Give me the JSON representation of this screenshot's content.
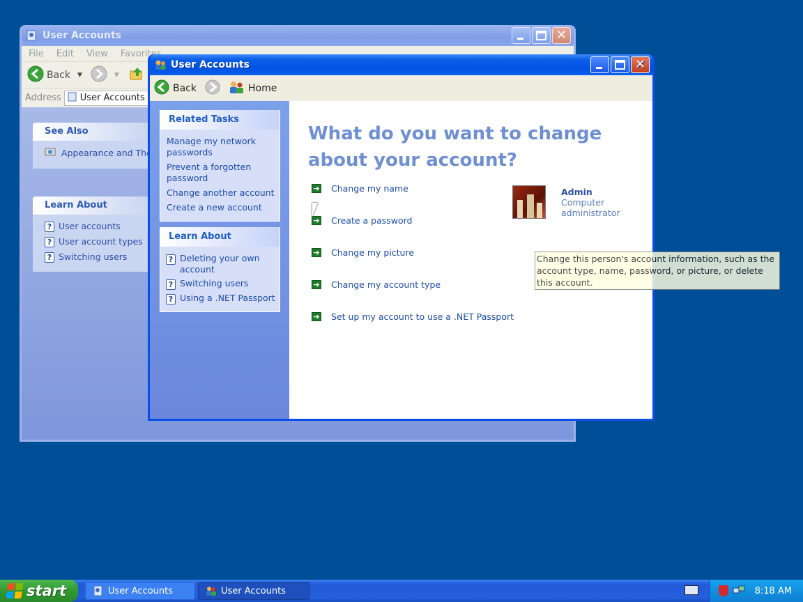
{
  "colors": {
    "desktop": "#004e98",
    "titlebar_active": "#0053e1",
    "link": "#1c4ba7",
    "headline": "#6f8fd3",
    "task_green": "#1f7a2c",
    "tooltip_bg": "#ffffe1"
  },
  "background_window": {
    "title": "User Accounts",
    "menu": [
      "File",
      "Edit",
      "View",
      "Favorites"
    ],
    "toolbar": {
      "back_label": "Back"
    },
    "address": {
      "label": "Address",
      "value": "User Accounts"
    },
    "see_also": {
      "header": "See Also",
      "items": [
        "Appearance and Ther"
      ]
    },
    "learn_about": {
      "header": "Learn About",
      "items": [
        "User accounts",
        "User account types",
        "Switching users"
      ]
    }
  },
  "foreground_window": {
    "title": "User Accounts",
    "toolbar": {
      "back_label": "Back",
      "home_label": "Home"
    },
    "related_tasks": {
      "header": "Related Tasks",
      "items": [
        "Manage my network passwords",
        "Prevent a forgotten password",
        "Change another account",
        "Create a new account"
      ]
    },
    "learn_about": {
      "header": "Learn About",
      "items": [
        "Deleting your own account",
        "Switching users",
        "Using a .NET Passport"
      ]
    },
    "headline": "What do you want to change about your account?",
    "actions": [
      "Change my name",
      "Create a password",
      "Change my picture",
      "Change my account type",
      "Set up my account to use a .NET Passport"
    ],
    "user": {
      "name": "Admin",
      "role": "Computer administrator"
    },
    "tooltip": "Change this person's account information, such as the account type, name, password, or picture, or delete this account."
  },
  "taskbar": {
    "start_label": "start",
    "buttons": [
      "User Accounts",
      "User Accounts"
    ],
    "clock": "8:18 AM"
  }
}
